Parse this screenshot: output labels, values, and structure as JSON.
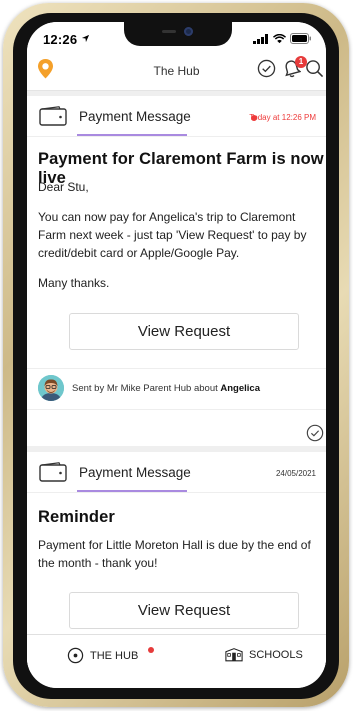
{
  "status_bar": {
    "time": "12:26"
  },
  "header": {
    "title": "The Hub",
    "notification_count": "1"
  },
  "messages": [
    {
      "type_label": "Payment Message",
      "date": "Today at 12:26 PM",
      "title": "Payment for Claremont Farm is now live",
      "greeting": "Dear Stu,",
      "body": "You can now pay for Angelica's trip to Claremont Farm next week - just tap 'View Request' to pay by credit/debit card or Apple/Google Pay.",
      "closing": "Many thanks.",
      "button_label": "View Request",
      "sender_prefix": "Sent by Mr Mike Parent Hub about",
      "sender_child": "Angelica"
    },
    {
      "type_label": "Payment Message",
      "date": "24/05/2021",
      "title": "Reminder",
      "body": "Payment for Little Moreton Hall is due by the end of the month - thank you!",
      "button_label": "View Request"
    }
  ],
  "tabs": [
    {
      "label": "THE HUB"
    },
    {
      "label": "SCHOOLS"
    }
  ],
  "colors": {
    "accent": "#a98ae0",
    "alert": "#e63b3b",
    "brand_orange": "#f4a02a"
  }
}
